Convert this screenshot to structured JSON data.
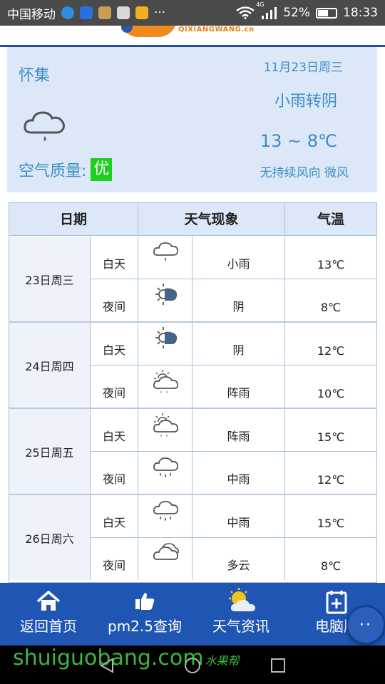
{
  "status_bar": {
    "carrier": "中国移动",
    "dots": "···",
    "network": "4G",
    "battery": "52%",
    "battery_level": 0.52,
    "time": "18:33"
  },
  "banner": {
    "logo_text": "QIXIANGWANG.cn"
  },
  "summary": {
    "city": "怀集",
    "date": "11月23日周三",
    "condition": "小雨转阴",
    "temperature": "13 ~ 8℃",
    "wind": "无持续风向 微风",
    "air_quality_label": "空气质量:",
    "air_quality_value": "优",
    "icon": "light-rain-cloud-icon"
  },
  "table": {
    "headers": {
      "date": "日期",
      "weather": "天气现象",
      "temperature": "气温"
    },
    "days": [
      {
        "date": "23日周三",
        "day": {
          "period": "白天",
          "condition": "小雨",
          "temp": "13℃",
          "icon": "light-rain-icon"
        },
        "night": {
          "period": "夜间",
          "condition": "阴",
          "temp": "8℃",
          "icon": "overcast-icon"
        }
      },
      {
        "date": "24日周四",
        "day": {
          "period": "白天",
          "condition": "阴",
          "temp": "12℃",
          "icon": "overcast-icon"
        },
        "night": {
          "period": "夜间",
          "condition": "阵雨",
          "temp": "10℃",
          "icon": "shower-icon"
        }
      },
      {
        "date": "25日周五",
        "day": {
          "period": "白天",
          "condition": "阵雨",
          "temp": "15℃",
          "icon": "shower-icon"
        },
        "night": {
          "period": "夜间",
          "condition": "中雨",
          "temp": "12℃",
          "icon": "moderate-rain-icon"
        }
      },
      {
        "date": "26日周六",
        "day": {
          "period": "白天",
          "condition": "中雨",
          "temp": "15℃",
          "icon": "moderate-rain-icon"
        },
        "night": {
          "period": "夜间",
          "condition": "多云",
          "temp": "8℃",
          "icon": "cloudy-icon"
        }
      }
    ]
  },
  "bottom_nav": {
    "home": "返回首页",
    "pm25": "pm2.5查询",
    "news": "天气资讯",
    "pc": "电脑版",
    "fab": "··"
  },
  "watermark": {
    "text": "shuiguobang.com",
    "sub": "水果帮"
  },
  "colors": {
    "accent": "#3b8fc4",
    "nav_bg": "#1f56b4",
    "card_bg": "#dce7f8",
    "aq_good": "#1ecf1e"
  }
}
